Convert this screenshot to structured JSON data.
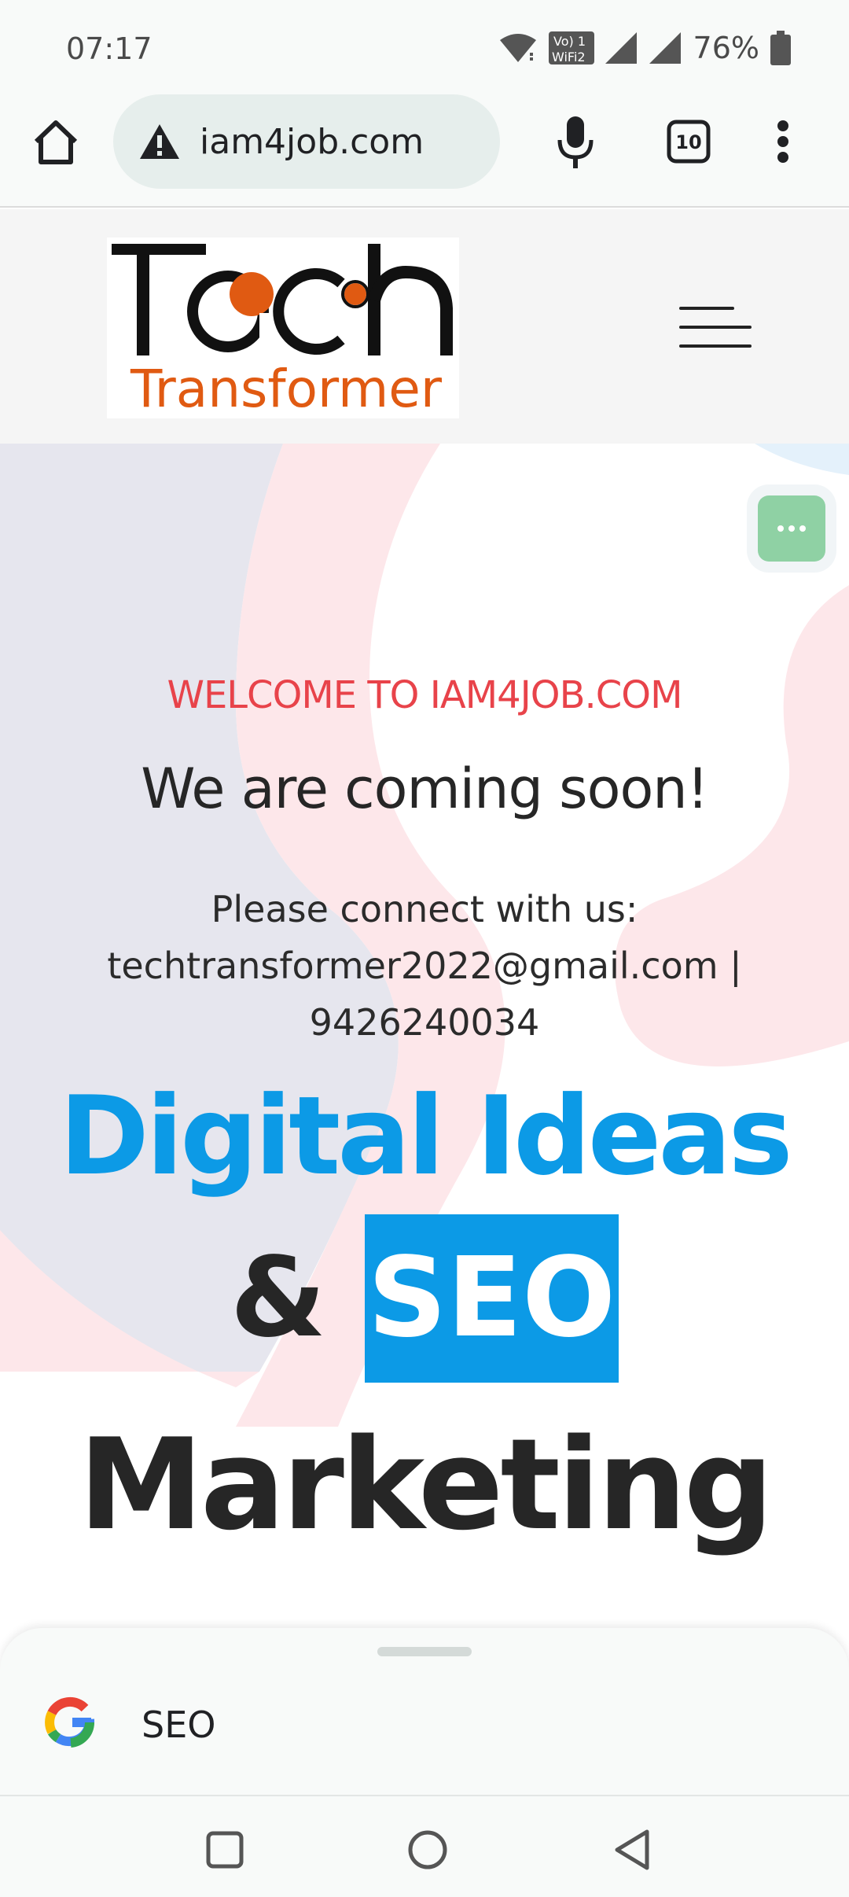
{
  "status_bar": {
    "time": "07:17",
    "battery_percent": "76%",
    "icons": [
      "wifi-icon",
      "vowifi-icon",
      "signal-icon",
      "signal-icon",
      "battery-icon"
    ],
    "vowifi_top": "Vo) 1",
    "vowifi_bottom": "WiFi2"
  },
  "browser": {
    "url": "iam4job.com",
    "tab_count": "10",
    "icons": [
      "home-icon",
      "warning-icon",
      "mic-icon",
      "tabs-icon",
      "more-vert-icon"
    ]
  },
  "site": {
    "logo": {
      "title": "Tech",
      "subtitle": "Transformer",
      "accent_color": "#e05a12"
    },
    "menu_icon": "hamburger-icon"
  },
  "hero": {
    "welcome": "WELCOME TO IAM4JOB.COM",
    "heading": "We are coming soon!",
    "connect_label": "Please connect with us:",
    "contact": "techtransformer2022@gmail.com | 9426240034",
    "title_line1": "Digital Ideas",
    "title_amp": "&",
    "title_seo": "SEO",
    "title_line3": "Marketing",
    "colors": {
      "welcome": "#e8434a",
      "accent_blue": "#0c9ae6",
      "chat_button": "#8fd1a4"
    }
  },
  "bottom_sheet": {
    "query": "SEO",
    "icon": "google-g-icon"
  },
  "navbar": {
    "icons": [
      "recents-icon",
      "home-circle-icon",
      "back-icon"
    ]
  }
}
